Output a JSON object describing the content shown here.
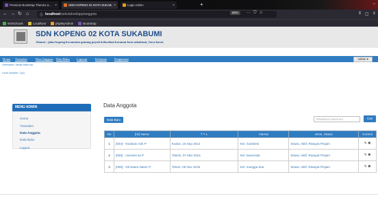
{
  "browser": {
    "tabs": [
      {
        "title": "Premium Bootstrap Themes a...",
        "active": false,
        "icon": "bootstrap-icon"
      },
      {
        "title": "SDN KOPENG 02 KOTA SUKAB...",
        "active": true,
        "icon": "site-icon"
      },
      {
        "title": "Login Admin",
        "active": false,
        "icon": "site-icon"
      }
    ],
    "url_host": "localhost",
    "url_path": "/sekolahsd/app/anggota",
    "zoom": "80%",
    "bookmarks": [
      {
        "label": "W3Schools",
        "color": "#4caf50"
      },
      {
        "label": "Localhost",
        "color": "#e0c040"
      },
      {
        "label": "phpMyAdmin",
        "color": "#f0a030"
      },
      {
        "label": "Bootstrap",
        "color": "#7952b3"
      }
    ]
  },
  "site": {
    "title": "SDN KOPENG 02 KOTA SUKABUMI",
    "subtitle": "Alamat : jalan kopeng kecamatan gunung puyuh kelurahan karamat kota sukabumi, Jawa barat."
  },
  "nav": {
    "items": [
      "Home",
      "Transaksi",
      "Data Anggota",
      "Data Buku",
      "Laporan",
      "Keluaran",
      "Pengaturan"
    ],
    "admin_label": "Admin"
  },
  "user": {
    "name_line": "Username: dimas bakti rhp",
    "role_line": "Level Number: 1(A)"
  },
  "sidebar": {
    "title": "MENU ADMIN",
    "items": [
      "Home",
      "Transaksi",
      "Data Anggota",
      "Data Buku",
      "Logout"
    ],
    "active_index": 2
  },
  "content": {
    "title": "Data Anggota",
    "new_button": "Data Baru",
    "search_placeholder": "Masukkan kata kunci",
    "search_button": "Cari",
    "columns": [
      "No",
      "[ID] Nama",
      "T T L",
      "Alamat",
      "Jenis, Status",
      "Control"
    ],
    "rows": [
      {
        "no": "1",
        "nama": "[004] - Nurdiani Ads P",
        "ttl": "Kudus, 16 Sep 2014",
        "alamat": "Kel. Gambesi",
        "status": "Siswa, Aktif, Riwayat Pinjam"
      },
      {
        "no": "2",
        "nama": "[005] - nursanti as P",
        "ttl": "Tobelo, 07 Mar 2015",
        "alamat": "Kel. kasumata",
        "status": "Siswa, Aktif, Riwayat Pinjam"
      },
      {
        "no": "3",
        "nama": "[006] - siti Niaea Naser P",
        "ttl": "Tidore, 09 Nov 2015",
        "alamat": "Kel. mangga dua",
        "status": "Siswa, Aktif, Riwayat Pinjam"
      }
    ]
  }
}
